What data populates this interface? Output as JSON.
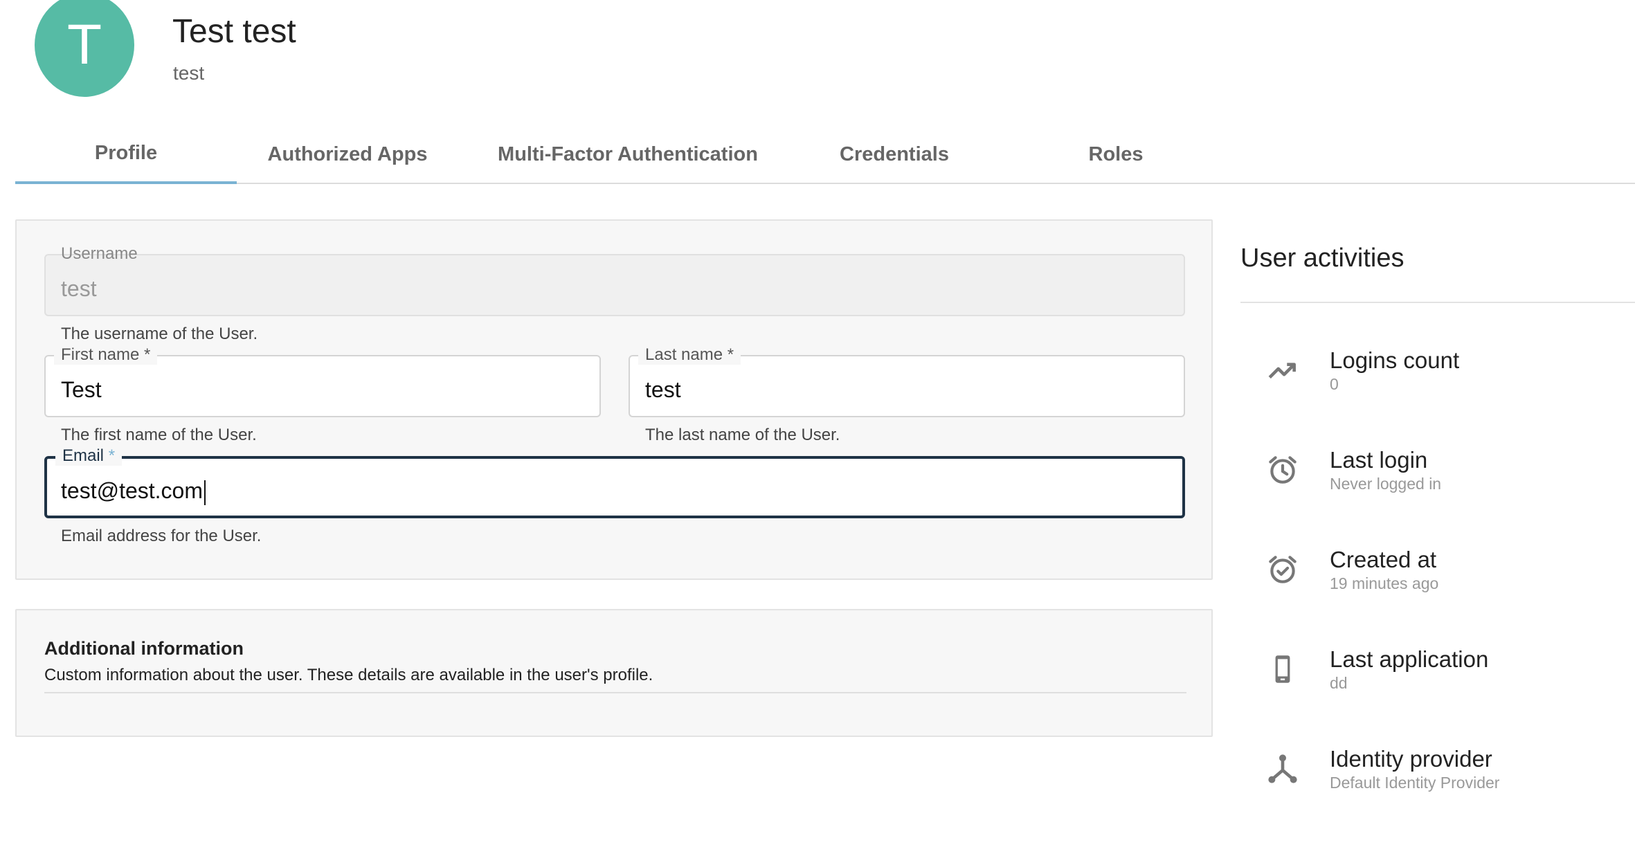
{
  "header": {
    "avatar_initial": "T",
    "full_name": "Test test",
    "username": "test"
  },
  "tabs": [
    {
      "label": "Profile",
      "active": true
    },
    {
      "label": "Authorized Apps",
      "active": false
    },
    {
      "label": "Multi-Factor Authentication",
      "active": false
    },
    {
      "label": "Credentials",
      "active": false
    },
    {
      "label": "Roles",
      "active": false
    }
  ],
  "form": {
    "username": {
      "label": "Username",
      "value": "test",
      "helper": "The username of the User."
    },
    "first_name": {
      "label": "First name *",
      "value": "Test",
      "helper": "The first name of the User."
    },
    "last_name": {
      "label": "Last name *",
      "value": "test",
      "helper": "The last name of the User."
    },
    "email": {
      "label": "Email",
      "required_mark": "*",
      "value": "test@test.com",
      "helper": "Email address for the User."
    }
  },
  "additional": {
    "title": "Additional information",
    "description": "Custom information about the user. These details are available in the user's profile."
  },
  "activities": {
    "title": "User activities",
    "items": [
      {
        "icon": "trending-up-icon",
        "title": "Logins count",
        "value": "0"
      },
      {
        "icon": "alarm-clock-icon",
        "title": "Last login",
        "value": "Never logged in"
      },
      {
        "icon": "alarm-check-icon",
        "title": "Created at",
        "value": "19 minutes ago"
      },
      {
        "icon": "phone-icon",
        "title": "Last application",
        "value": "dd"
      },
      {
        "icon": "identity-provider-icon",
        "title": "Identity provider",
        "value": "Default Identity Provider"
      }
    ]
  },
  "colors": {
    "avatar": "#56bba5",
    "tab_indicator": "#7ab3d3",
    "focus_border": "#1f3346"
  }
}
